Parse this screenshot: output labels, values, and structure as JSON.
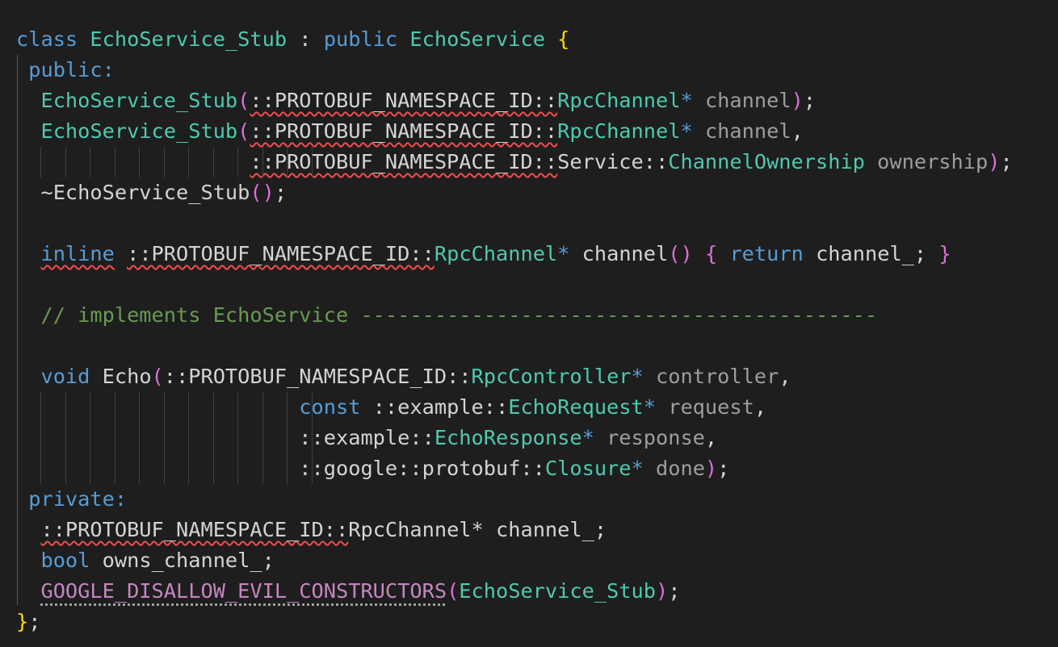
{
  "editor": {
    "theme": "dark",
    "colors": {
      "background": "#1e1e1e",
      "keyword": "#569cd6",
      "type": "#4ec9b0",
      "function": "#dcdcaa",
      "plain": "#d4d4d4",
      "parameter": "#9d9d9d",
      "comment": "#6a9955",
      "macro": "#c586c0",
      "bracket_level1": "#ffd700",
      "bracket_level2": "#da70d6",
      "bracket_level3": "#179fff",
      "error_squiggle": "#f14c4c"
    },
    "lines": [
      {
        "tokens": [
          {
            "t": "class",
            "c": "kw"
          },
          {
            "t": " ",
            "c": "pl"
          },
          {
            "t": "EchoService_Stub",
            "c": "ty"
          },
          {
            "t": " : ",
            "c": "pl"
          },
          {
            "t": "public",
            "c": "kw"
          },
          {
            "t": " ",
            "c": "pl"
          },
          {
            "t": "EchoService",
            "c": "ty"
          },
          {
            "t": " ",
            "c": "pl"
          },
          {
            "t": "{",
            "c": "b1"
          }
        ]
      },
      {
        "tokens": [
          {
            "t": " ",
            "c": "pl"
          },
          {
            "t": "public",
            "c": "kw"
          },
          {
            "t": ":",
            "c": "kw"
          }
        ]
      },
      {
        "tokens": [
          {
            "t": "  ",
            "c": "pl"
          },
          {
            "t": "EchoService_Stub",
            "c": "ty"
          },
          {
            "t": "(",
            "c": "b2"
          },
          {
            "t": "::PROTOBUF_NAMESPACE_ID::",
            "c": "pl",
            "err": true
          },
          {
            "t": "RpcChannel",
            "c": "ty"
          },
          {
            "t": "*",
            "c": "kw"
          },
          {
            "t": " ",
            "c": "pl"
          },
          {
            "t": "channel",
            "c": "pa-dim"
          },
          {
            "t": ")",
            "c": "b2"
          },
          {
            "t": ";",
            "c": "pl"
          }
        ]
      },
      {
        "tokens": [
          {
            "t": "  ",
            "c": "pl"
          },
          {
            "t": "EchoService_Stub",
            "c": "ty"
          },
          {
            "t": "(",
            "c": "b2"
          },
          {
            "t": "::PROTOBUF_NAMESPACE_ID::",
            "c": "pl",
            "err": true
          },
          {
            "t": "RpcChannel",
            "c": "ty"
          },
          {
            "t": "*",
            "c": "kw"
          },
          {
            "t": " ",
            "c": "pl"
          },
          {
            "t": "channel",
            "c": "pa-dim"
          },
          {
            "t": ",",
            "c": "pl"
          }
        ]
      },
      {
        "guides": 12,
        "tokens": [
          {
            "t": "                   ",
            "c": "pl"
          },
          {
            "t": "::PROTOBUF_NAMESPACE_ID::",
            "c": "pl",
            "err": true
          },
          {
            "t": "Service",
            "c": "pl"
          },
          {
            "t": "::",
            "c": "pl"
          },
          {
            "t": "ChannelOwnership",
            "c": "ty"
          },
          {
            "t": " ",
            "c": "pl"
          },
          {
            "t": "ownership",
            "c": "pa-dim"
          },
          {
            "t": ")",
            "c": "b2"
          },
          {
            "t": ";",
            "c": "pl"
          }
        ]
      },
      {
        "tokens": [
          {
            "t": "  ",
            "c": "pl"
          },
          {
            "t": "~EchoService_Stub",
            "c": "pl"
          },
          {
            "t": "()",
            "c": "b2"
          },
          {
            "t": ";",
            "c": "pl"
          }
        ]
      },
      {
        "tokens": [
          {
            "t": "",
            "c": "pl"
          }
        ]
      },
      {
        "tokens": [
          {
            "t": "  ",
            "c": "pl"
          },
          {
            "t": "inline",
            "c": "kw",
            "err": true
          },
          {
            "t": " ",
            "c": "pl"
          },
          {
            "t": "::PROTOBUF_NAMESPACE_ID::",
            "c": "pl",
            "err": true
          },
          {
            "t": "RpcChannel",
            "c": "ty"
          },
          {
            "t": "*",
            "c": "kw"
          },
          {
            "t": " ",
            "c": "pl"
          },
          {
            "t": "channel",
            "c": "pl"
          },
          {
            "t": "()",
            "c": "b2"
          },
          {
            "t": " ",
            "c": "pl"
          },
          {
            "t": "{",
            "c": "b2"
          },
          {
            "t": " ",
            "c": "pl"
          },
          {
            "t": "return",
            "c": "kw"
          },
          {
            "t": " ",
            "c": "pl"
          },
          {
            "t": "channel_;",
            "c": "pl"
          },
          {
            "t": " ",
            "c": "pl"
          },
          {
            "t": "}",
            "c": "b2"
          }
        ]
      },
      {
        "tokens": [
          {
            "t": "",
            "c": "pl"
          }
        ]
      },
      {
        "tokens": [
          {
            "t": "  ",
            "c": "pl"
          },
          {
            "t": "// implements EchoService ------------------------------------------",
            "c": "cm"
          }
        ]
      },
      {
        "tokens": [
          {
            "t": "",
            "c": "pl"
          }
        ]
      },
      {
        "tokens": [
          {
            "t": "  ",
            "c": "pl"
          },
          {
            "t": "void",
            "c": "kw"
          },
          {
            "t": " ",
            "c": "pl"
          },
          {
            "t": "Echo",
            "c": "pl"
          },
          {
            "t": "(",
            "c": "b2"
          },
          {
            "t": "::PROTOBUF_NAMESPACE_ID::",
            "c": "pl"
          },
          {
            "t": "RpcController",
            "c": "ty"
          },
          {
            "t": "*",
            "c": "kw"
          },
          {
            "t": " ",
            "c": "pl"
          },
          {
            "t": "controller",
            "c": "pa-dim"
          },
          {
            "t": ",",
            "c": "pl"
          }
        ]
      },
      {
        "guides": 12,
        "tokens": [
          {
            "t": "                       ",
            "c": "pl"
          },
          {
            "t": "const",
            "c": "kw"
          },
          {
            "t": " ",
            "c": "pl"
          },
          {
            "t": "::example::",
            "c": "pl"
          },
          {
            "t": "EchoRequest",
            "c": "ty"
          },
          {
            "t": "*",
            "c": "kw"
          },
          {
            "t": " ",
            "c": "pl"
          },
          {
            "t": "request",
            "c": "pa-dim"
          },
          {
            "t": ",",
            "c": "pl"
          }
        ]
      },
      {
        "guides": 12,
        "tokens": [
          {
            "t": "                       ",
            "c": "pl"
          },
          {
            "t": "::example::",
            "c": "pl"
          },
          {
            "t": "EchoResponse",
            "c": "ty"
          },
          {
            "t": "*",
            "c": "kw"
          },
          {
            "t": " ",
            "c": "pl"
          },
          {
            "t": "response",
            "c": "pa-dim"
          },
          {
            "t": ",",
            "c": "pl"
          }
        ]
      },
      {
        "guides": 12,
        "tokens": [
          {
            "t": "                       ",
            "c": "pl"
          },
          {
            "t": "::google::protobuf::",
            "c": "pl"
          },
          {
            "t": "Closure",
            "c": "ty"
          },
          {
            "t": "*",
            "c": "kw"
          },
          {
            "t": " ",
            "c": "pl"
          },
          {
            "t": "done",
            "c": "pa-dim"
          },
          {
            "t": ")",
            "c": "b2"
          },
          {
            "t": ";",
            "c": "pl"
          }
        ]
      },
      {
        "tokens": [
          {
            "t": " ",
            "c": "pl"
          },
          {
            "t": "private",
            "c": "kw"
          },
          {
            "t": ":",
            "c": "kw"
          }
        ]
      },
      {
        "tokens": [
          {
            "t": "  ",
            "c": "pl"
          },
          {
            "t": "::PROTOBUF_NAMESPACE_ID::",
            "c": "pl",
            "err": true
          },
          {
            "t": "RpcChannel",
            "c": "pl"
          },
          {
            "t": "*",
            "c": "pl"
          },
          {
            "t": " ",
            "c": "pl"
          },
          {
            "t": "channel_;",
            "c": "pl"
          }
        ]
      },
      {
        "tokens": [
          {
            "t": "  ",
            "c": "pl"
          },
          {
            "t": "bool",
            "c": "kw"
          },
          {
            "t": " ",
            "c": "pl"
          },
          {
            "t": "owns_channel_;",
            "c": "pl"
          }
        ]
      },
      {
        "tokens": [
          {
            "t": "  ",
            "c": "pl"
          },
          {
            "t": "GOOGLE_DISALLOW_EVIL_CONSTRUCTORS",
            "c": "ma",
            "dots": true
          },
          {
            "t": "(",
            "c": "b2"
          },
          {
            "t": "EchoService_Stub",
            "c": "ty"
          },
          {
            "t": ")",
            "c": "b2"
          },
          {
            "t": ";",
            "c": "pl"
          }
        ]
      },
      {
        "tokens": [
          {
            "t": "}",
            "c": "b1"
          },
          {
            "t": ";",
            "c": "pl"
          }
        ]
      }
    ]
  }
}
